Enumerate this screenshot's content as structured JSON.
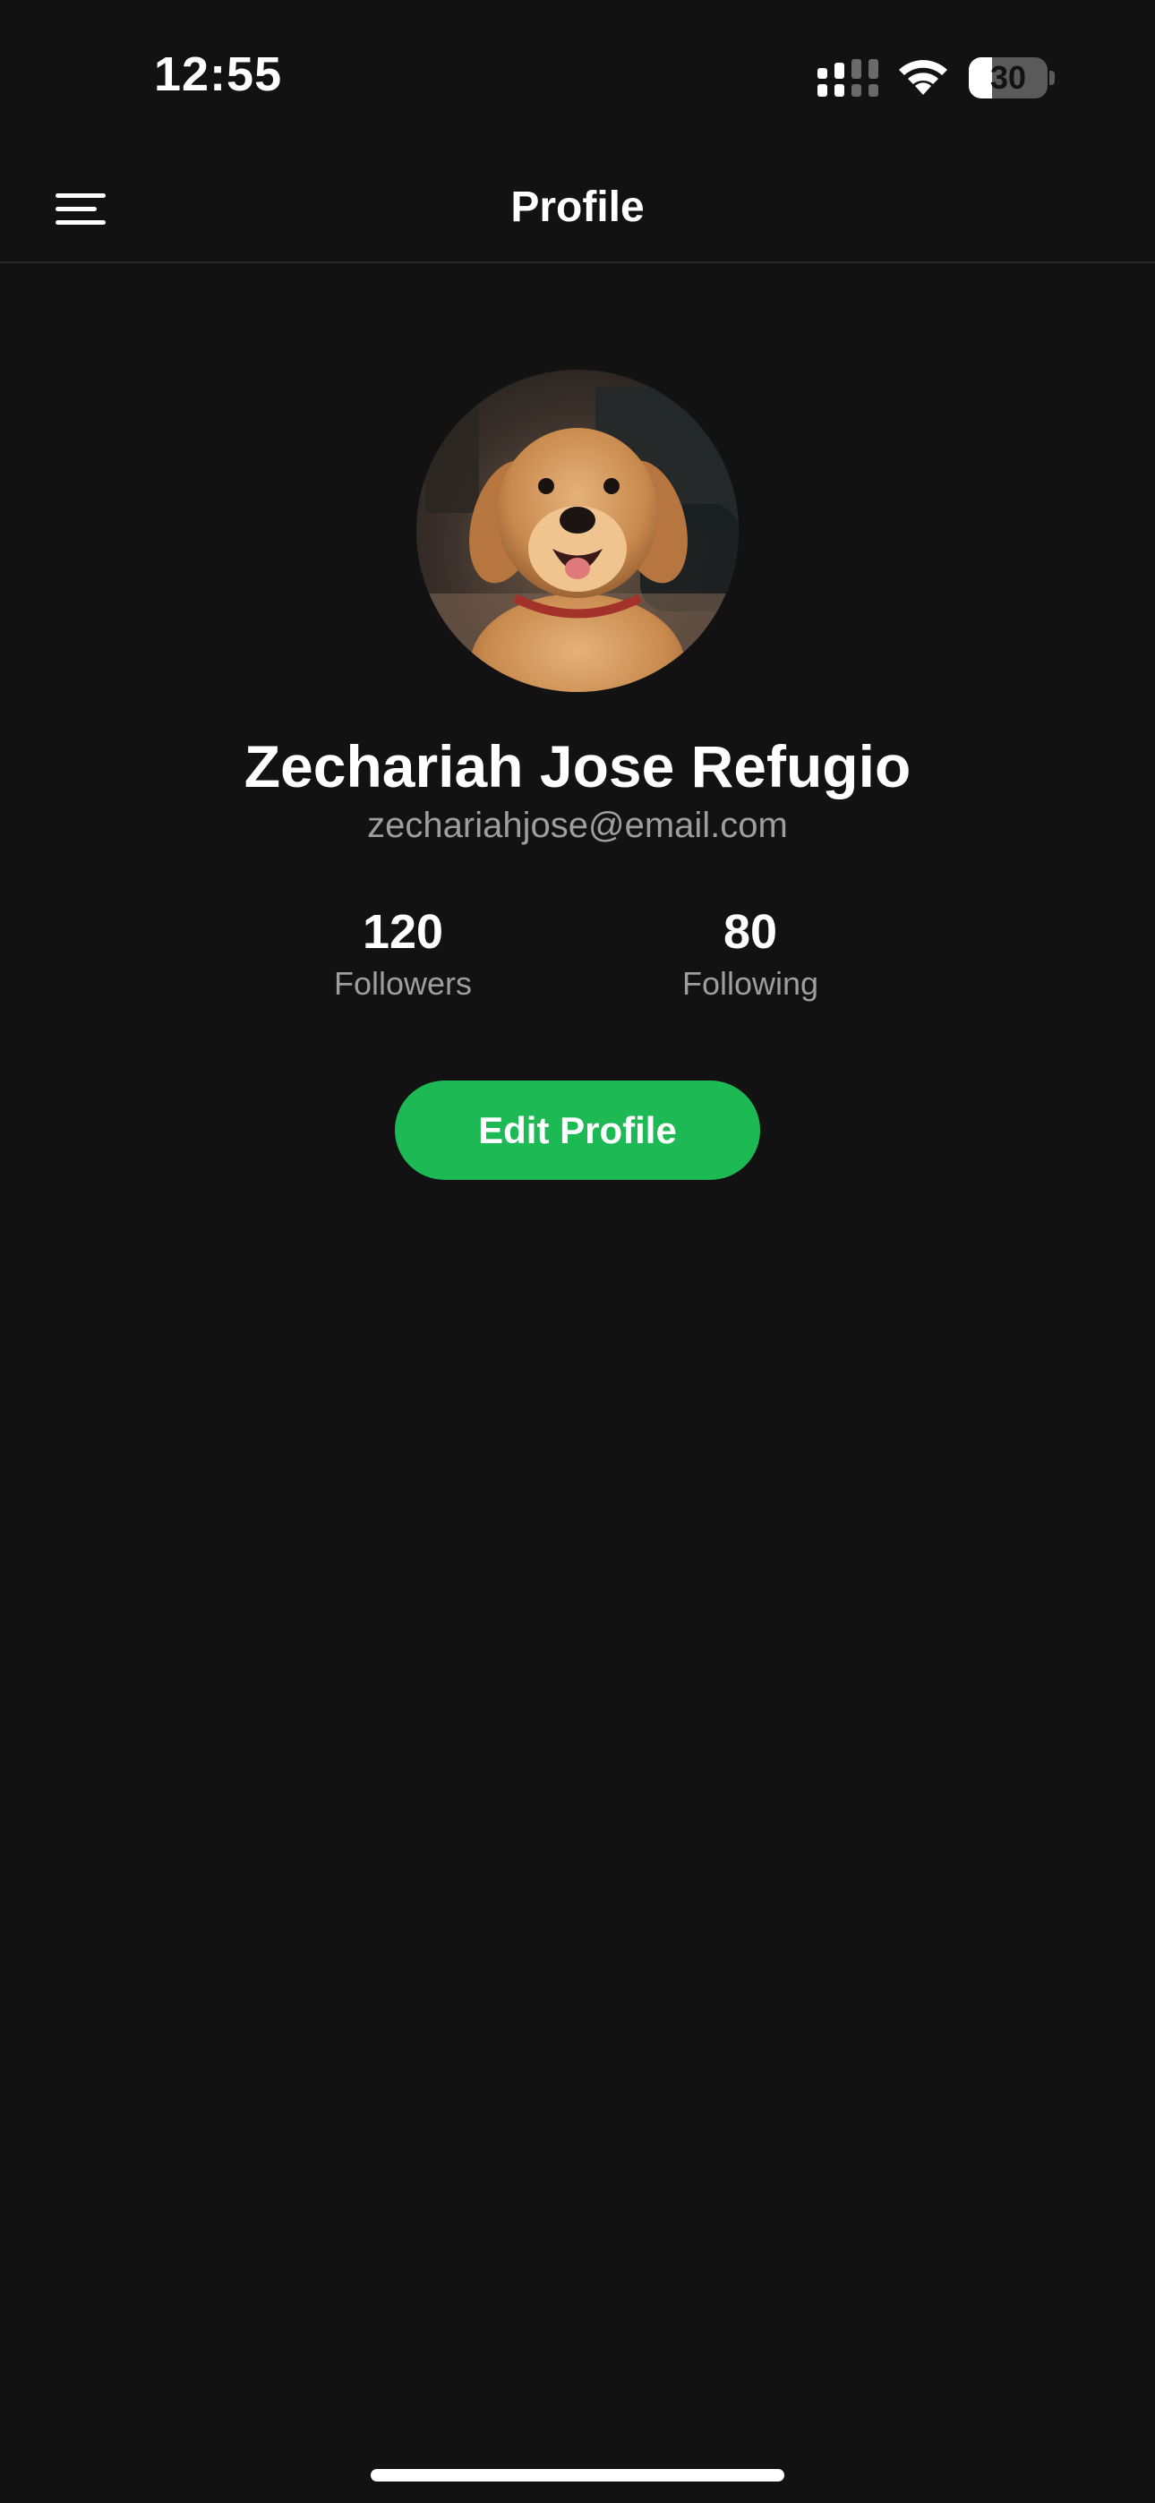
{
  "status_bar": {
    "time": "12:55",
    "battery_level": "30",
    "battery_fraction": 0.3,
    "signal_icon": "cellular-signal-icon",
    "wifi_icon": "wifi-icon"
  },
  "header": {
    "menu_icon": "hamburger-menu-icon",
    "title": "Profile"
  },
  "profile": {
    "avatar": "golden-retriever-photo",
    "name": "Zechariah Jose Refugio",
    "email": "zechariahjose@email.com",
    "stats": [
      {
        "value": "120",
        "label": "Followers"
      },
      {
        "value": "80",
        "label": "Following"
      }
    ],
    "edit_button_label": "Edit Profile"
  },
  "colors": {
    "background": "#121212",
    "accent": "#1db954",
    "secondary_text": "#9e9e9e",
    "divider": "#2a2a2a"
  }
}
